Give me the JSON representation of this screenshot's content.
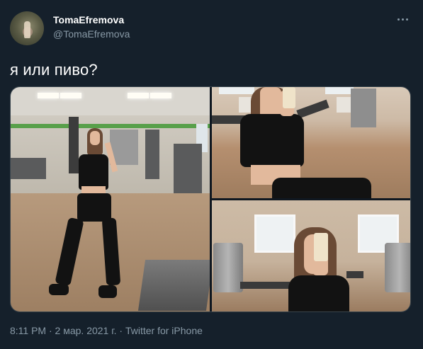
{
  "tweet": {
    "author": {
      "display_name": "TomaEfremova",
      "handle": "@TomaEfremova",
      "avatar_icon": "avatar-photo-icon"
    },
    "more_icon": "more-options-icon",
    "text": "я или пиво?",
    "media": {
      "photo_count": 3,
      "photos": [
        "gym-full-body-photo",
        "gym-mirror-selfie-photo",
        "gym-phone-selfie-photo"
      ]
    },
    "meta": "8:11 PM · 2 мар. 2021 г. · Twitter for iPhone"
  },
  "colors": {
    "background": "#15202b",
    "primary_text": "#ffffff",
    "secondary_text": "#8899a6",
    "border": "#38444d"
  }
}
